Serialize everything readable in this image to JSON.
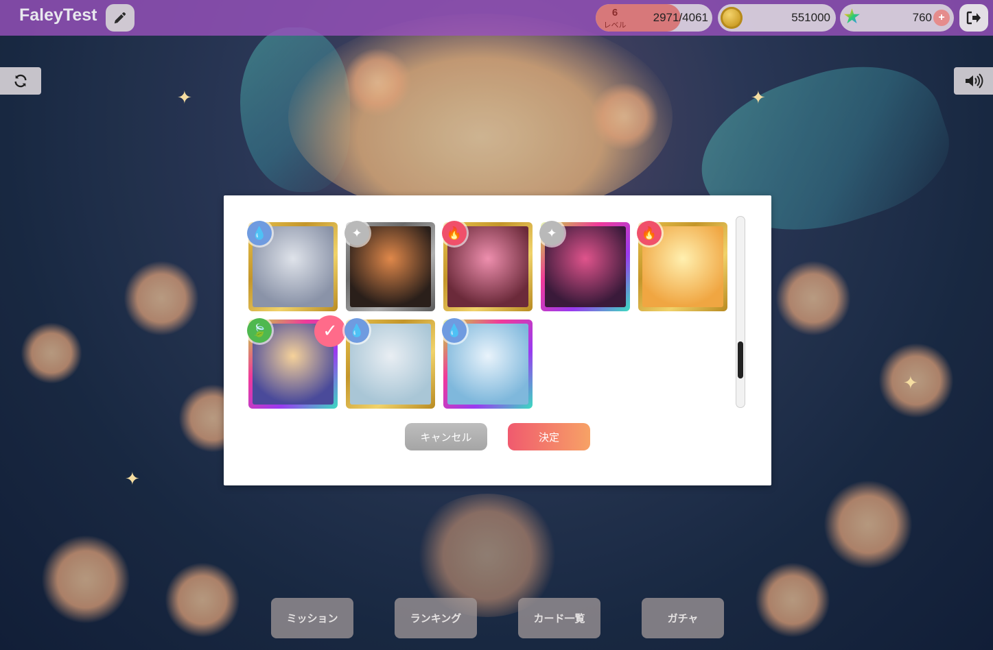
{
  "header": {
    "app_title": "FaleyTest",
    "level": {
      "value": "6",
      "label": "レベル"
    },
    "exp": {
      "current": 2971,
      "max": 4061,
      "text": "2971/4061"
    },
    "coins": "551000",
    "stars": "760",
    "icons": [
      "pencil-icon",
      "coin-icon",
      "star-icon",
      "plus-icon",
      "logout-icon"
    ]
  },
  "side": {
    "icons": [
      "refresh-icon",
      "volume-icon"
    ]
  },
  "modal": {
    "cards": [
      {
        "element": "water",
        "frame": "gold",
        "colors": [
          "#8a93a8",
          "#dfe3ea"
        ]
      },
      {
        "element": "light",
        "frame": "silver",
        "colors": [
          "#2a1f1a",
          "#e0884a"
        ]
      },
      {
        "element": "fire",
        "frame": "gold",
        "colors": [
          "#6b2a3a",
          "#ee8fae"
        ]
      },
      {
        "element": "light",
        "frame": "rainbow",
        "colors": [
          "#3a1a3a",
          "#e0548c"
        ]
      },
      {
        "element": "fire",
        "frame": "gold",
        "colors": [
          "#f0a642",
          "#fff0b0"
        ]
      },
      {
        "element": "leaf",
        "frame": "rainbow",
        "colors": [
          "#4a4a9a",
          "#f6d29a"
        ],
        "selected": true
      },
      {
        "element": "water",
        "frame": "gold",
        "colors": [
          "#a9c6d6",
          "#e9eef3"
        ]
      },
      {
        "element": "water",
        "frame": "rainbow",
        "colors": [
          "#7fb8dc",
          "#e9f3fb"
        ]
      }
    ],
    "scroll_position": 0.82,
    "cancel_label": "キャンセル",
    "confirm_label": "決定"
  },
  "bottom_nav": {
    "mission": "ミッション",
    "ranking": "ランキング",
    "card_list": "カード一覧",
    "gacha": "ガチャ"
  },
  "colors": {
    "topbar": "#9650b9",
    "level_badge": "#d86a6a",
    "confirm_gradient": [
      "#f05a6e",
      "#f7a266"
    ],
    "selected_check": "#ff6b8a"
  }
}
